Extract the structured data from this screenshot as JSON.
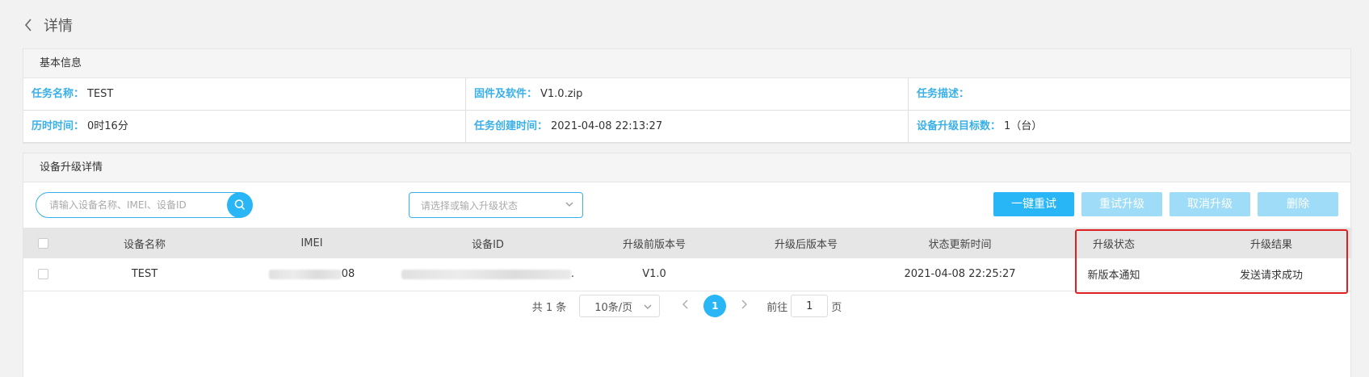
{
  "header": {
    "title": "详情"
  },
  "basic_info": {
    "title": "基本信息",
    "rows": [
      [
        {
          "label": "任务名称：",
          "value": "TEST"
        },
        {
          "label": "固件及软件：",
          "value": "V1.0.zip"
        },
        {
          "label": "任务描述：",
          "value": ""
        }
      ],
      [
        {
          "label": "历时时间：",
          "value": "0时16分"
        },
        {
          "label": "任务创建时间：",
          "value": "2021-04-08 22:13:27"
        },
        {
          "label": "设备升级目标数：",
          "value": "1（台）"
        }
      ]
    ]
  },
  "device_panel": {
    "title": "设备升级详情",
    "search_placeholder": "请输入设备名称、IMEI、设备ID",
    "status_placeholder": "请选择或输入升级状态",
    "buttons": {
      "retry_all": "一键重试",
      "retry_upgrade": "重试升级",
      "cancel_upgrade": "取消升级",
      "delete": "删除"
    },
    "columns": [
      "设备名称",
      "IMEI",
      "设备ID",
      "升级前版本号",
      "升级后版本号",
      "状态更新时间",
      "升级状态",
      "升级结果"
    ],
    "rows": [
      {
        "name": "TEST",
        "imei_suffix": "08",
        "device_id_suffix": ".",
        "before_version": "V1.0",
        "after_version": "",
        "update_time": "2021-04-08 22:25:27",
        "status": "新版本通知",
        "result": "发送请求成功"
      }
    ]
  },
  "pagination": {
    "total_text": "共 1 条",
    "page_size": "10条/页",
    "current_page": "1",
    "goto_label": "前往",
    "goto_value": "1",
    "page_unit": "页"
  },
  "colors": {
    "accent": "#29b6f6",
    "label": "#3ab0e8",
    "disabled": "#9edcf7",
    "highlight": "#e02020"
  }
}
